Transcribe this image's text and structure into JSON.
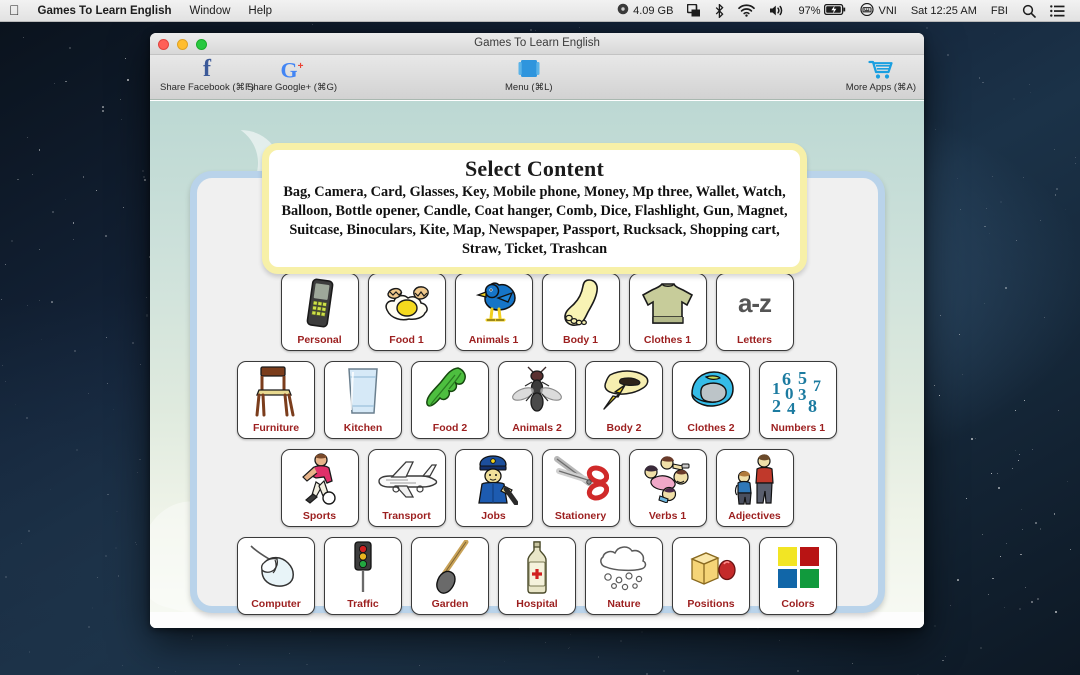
{
  "menubar": {
    "apple_icon": "apple-logo",
    "app_name": "Games To Learn English",
    "items": [
      "Window",
      "Help"
    ],
    "status": {
      "memory": "4.09 GB",
      "memory_icon": "disk-icon",
      "airplay_icon": "airplay-icon",
      "bluetooth_icon": "bluetooth-icon",
      "wifi_icon": "wifi-icon",
      "volume_icon": "volume-icon",
      "battery_percent": "97%",
      "battery_icon": "battery-charging-icon",
      "input_source_icon": "keyboard-icon",
      "input_source": "VNI",
      "clock": "Sat 12:25 AM",
      "user": "FBI",
      "search_icon": "search-icon",
      "notification_icon": "notification-center-icon"
    }
  },
  "window": {
    "title": "Games To Learn English",
    "toolbar": {
      "share_facebook": "Share Facebook (⌘F)",
      "share_facebook_icon": "facebook-icon",
      "share_google": "Share Google+ (⌘G)",
      "share_google_icon": "google-plus-icon",
      "menu": "Menu (⌘L)",
      "menu_icon": "book-icon",
      "more_apps": "More Apps (⌘A)",
      "more_apps_icon": "shopping-cart-icon"
    }
  },
  "callout": {
    "title": "Select Content",
    "words": "Bag, Camera, Card, Glasses, Key, Mobile phone, Money, Mp three, Wallet, Watch, Balloon, Bottle opener, Candle, Coat hanger, Comb, Dice, Flashlight, Gun, Magnet, Suitcase, Binoculars, Kite, Map, Newspaper, Passport, Rucksack, Shopping cart, Straw, Ticket, Trashcan"
  },
  "colors": {
    "label_red": "#9c1f1f",
    "panel_border": "#b9d3ea",
    "callout_border": "#f7f0a8",
    "number_blue": "#1c7ba0"
  },
  "grid": {
    "rows": [
      [
        {
          "label": "Personal",
          "icon": "mobile-phone-icon"
        },
        {
          "label": "Food 1",
          "icon": "fried-egg-icon"
        },
        {
          "label": "Animals 1",
          "icon": "bird-icon"
        },
        {
          "label": "Body 1",
          "icon": "foot-icon"
        },
        {
          "label": "Clothes 1",
          "icon": "sweater-icon"
        },
        {
          "label": "Letters",
          "icon": "a-z-icon"
        }
      ],
      [
        {
          "label": "Furniture",
          "icon": "chair-icon"
        },
        {
          "label": "Kitchen",
          "icon": "glass-icon"
        },
        {
          "label": "Food 2",
          "icon": "celery-icon"
        },
        {
          "label": "Animals 2",
          "icon": "fly-icon"
        },
        {
          "label": "Body 2",
          "icon": "eyebrow-icon"
        },
        {
          "label": "Clothes 2",
          "icon": "helmet-icon"
        },
        {
          "label": "Numbers 1",
          "icon": "numbers-icon"
        }
      ],
      [
        {
          "label": "Sports",
          "icon": "soccer-player-icon"
        },
        {
          "label": "Transport",
          "icon": "airplane-icon"
        },
        {
          "label": "Jobs",
          "icon": "police-officer-icon"
        },
        {
          "label": "Stationery",
          "icon": "scissors-icon"
        },
        {
          "label": "Verbs 1",
          "icon": "people-actions-icon"
        },
        {
          "label": "Adjectives",
          "icon": "two-people-icon"
        }
      ],
      [
        {
          "label": "Computer",
          "icon": "mouse-icon"
        },
        {
          "label": "Traffic",
          "icon": "traffic-light-icon"
        },
        {
          "label": "Garden",
          "icon": "spade-icon"
        },
        {
          "label": "Hospital",
          "icon": "medicine-bottle-icon"
        },
        {
          "label": "Nature",
          "icon": "rain-cloud-icon"
        },
        {
          "label": "Positions",
          "icon": "cube-ball-icon"
        },
        {
          "label": "Colors",
          "icon": "color-swatches-icon"
        }
      ]
    ],
    "numbers_tile": {
      "digits": [
        "1",
        "6",
        "5",
        "7",
        "0",
        "3",
        "2",
        "4",
        "8"
      ]
    },
    "colors_tile": {
      "swatches": [
        "#f2e524",
        "#b81414",
        "#1166a8",
        "#119a3d"
      ]
    },
    "letters_tile": {
      "text": "a-z"
    }
  }
}
